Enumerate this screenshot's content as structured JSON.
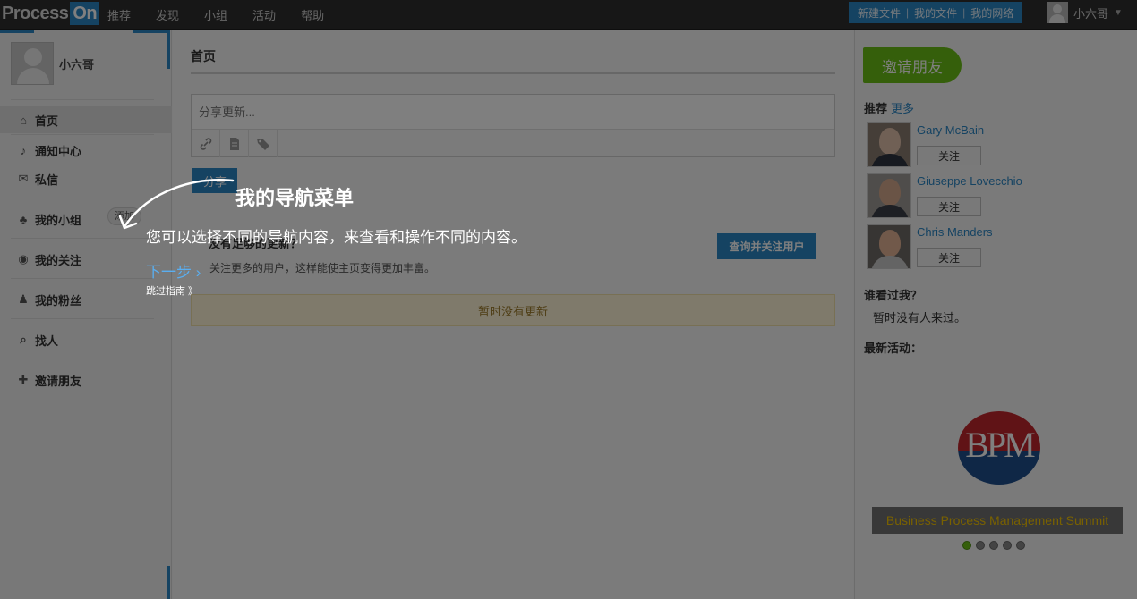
{
  "topbar": {
    "logo_main": "Process",
    "logo_accent": "On",
    "nav": [
      "推荐",
      "发现",
      "小组",
      "活动",
      "帮助"
    ],
    "actions": [
      "新建文件",
      "我的文件",
      "我的网络"
    ],
    "user_name": "小六哥",
    "caret": "▼"
  },
  "sidebar": {
    "profile_name": "小六哥",
    "items": [
      {
        "label": "首页",
        "icon": "home-icon",
        "glyph": "⌂"
      },
      {
        "label": "通知中心",
        "icon": "bell-icon",
        "glyph": "♪"
      },
      {
        "label": "私信",
        "icon": "mail-icon",
        "glyph": "✉"
      },
      {
        "label": "我的小组",
        "icon": "group-icon",
        "glyph": "♣"
      },
      {
        "label": "我的关注",
        "icon": "eye-icon",
        "glyph": "◉"
      },
      {
        "label": "我的粉丝",
        "icon": "fans-icon",
        "glyph": "♟"
      },
      {
        "label": "找人",
        "icon": "search-icon",
        "glyph": "⌕"
      },
      {
        "label": "邀请朋友",
        "icon": "plus-icon",
        "glyph": "✚"
      }
    ],
    "group_add_label": "添加"
  },
  "main": {
    "title": "首页",
    "share_placeholder": "分享更新...",
    "share_button": "分享",
    "follow_title": "没有足够的更新？",
    "follow_desc": "关注更多的用户，这样能使主页变得更加丰富。",
    "follow_button": "查询并关注用户",
    "no_updates": "暂时没有更新"
  },
  "right": {
    "invite_button": "邀请朋友",
    "recommend_title": "推荐",
    "recommend_more": "更多",
    "recommendations": [
      {
        "name": "Gary McBain",
        "follow": "关注"
      },
      {
        "name": "Giuseppe Lovecchio",
        "follow": "关注"
      },
      {
        "name": "Chris Manders",
        "follow": "关注"
      }
    ],
    "viewed_title": "谁看过我？",
    "viewed_text": "暂时没有人来过。",
    "activity_title": "最新活动：",
    "banner_logo": "BPM",
    "banner_caption": "Business Process Management Summit",
    "carousel_count": 5,
    "carousel_active": 0
  },
  "guide": {
    "title": "我的导航菜单",
    "description": "您可以选择不同的导航内容，来查看和操作不同的内容。",
    "next": "下一步 ›",
    "skip": "跳过指南 》"
  },
  "colors": {
    "accent_blue": "#2b86c5",
    "invite_green": "#6bbf17",
    "banner_yellow": "#f2c200"
  }
}
